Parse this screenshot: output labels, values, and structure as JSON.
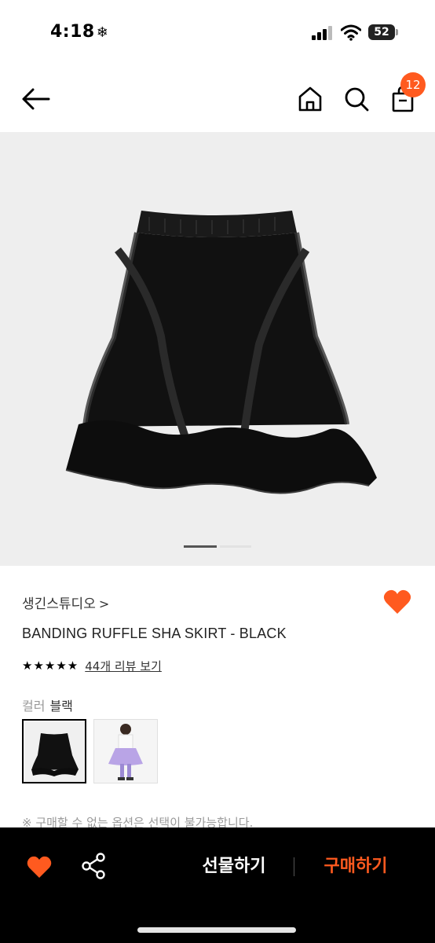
{
  "status_bar": {
    "time": "4:18",
    "time_icon": "snowflake-icon",
    "battery_level": "52"
  },
  "header": {
    "cart_badge_count": "12"
  },
  "gallery": {
    "current_index": 1,
    "total": 2
  },
  "product": {
    "brand": "생긴스튜디오",
    "brand_chevron": ">",
    "title": "BANDING RUFFLE SHA SKIRT - BLACK",
    "stars": "★★★★★",
    "rating_stars_count": 5,
    "review_link": "44개 리뷰 보기",
    "liked": true
  },
  "options": {
    "color_label": "컬러",
    "color_value": "블랙",
    "selected_thumbnail": 1
  },
  "notice": "※ 구매할 수 없는 옵션은 선택이 불가능합니다.",
  "bottom_bar": {
    "gift_label": "선물하기",
    "buy_label": "구매하기"
  },
  "colors": {
    "accent": "#ff5a1f",
    "bottom_bar_bg": "#000000",
    "image_bg": "#eeeeee"
  }
}
